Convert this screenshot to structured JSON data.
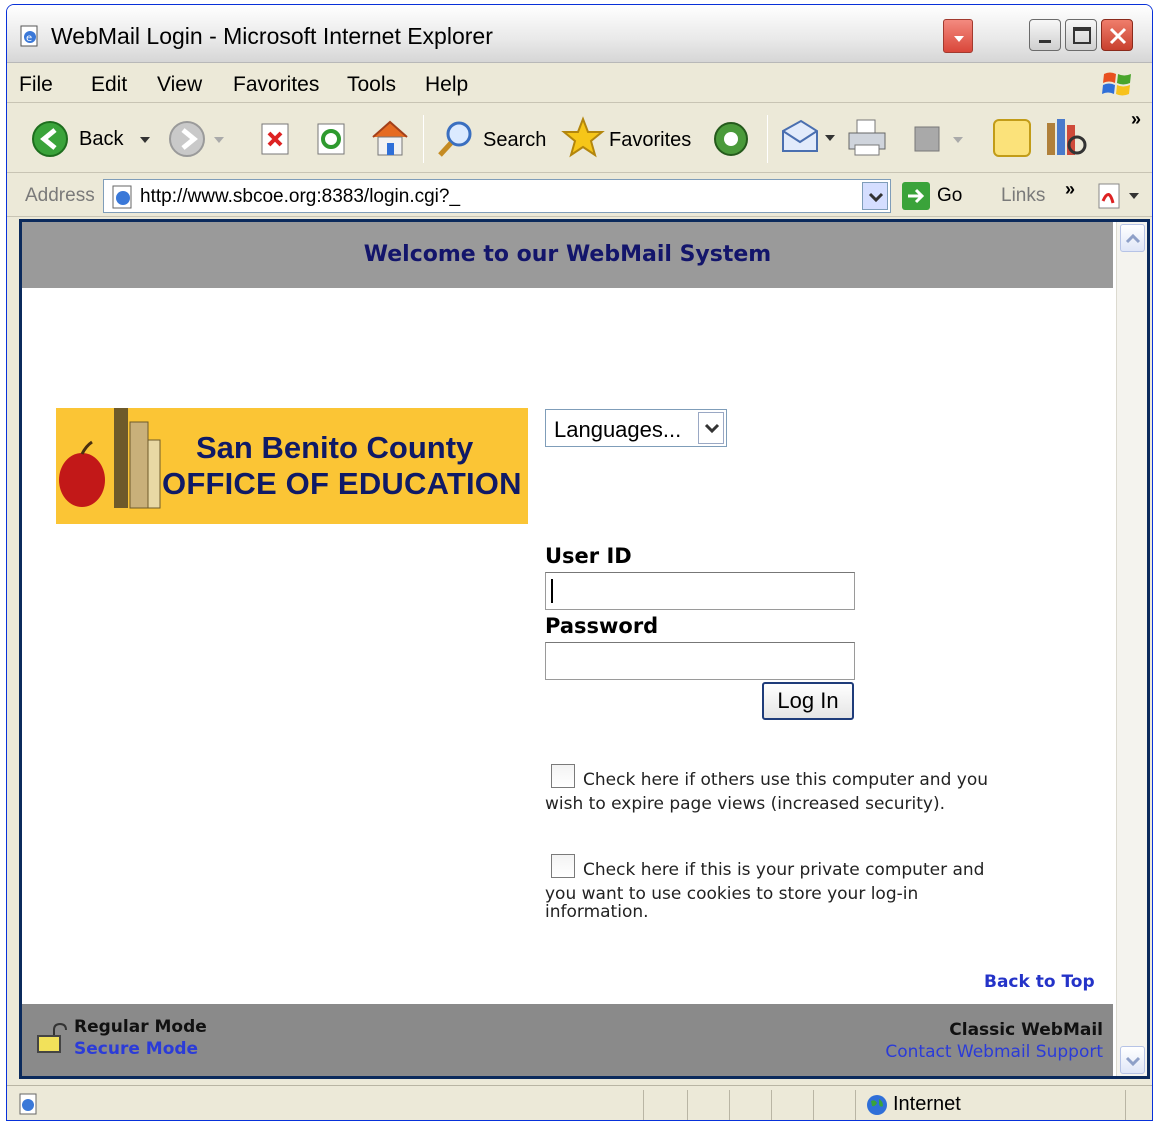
{
  "window": {
    "title": "WebMail Login - Microsoft Internet Explorer"
  },
  "menu": {
    "items": [
      {
        "label": "File",
        "accel": "F"
      },
      {
        "label": "Edit",
        "accel": "E"
      },
      {
        "label": "View",
        "accel": "V"
      },
      {
        "label": "Favorites",
        "accel": "a"
      },
      {
        "label": "Tools",
        "accel": "T"
      },
      {
        "label": "Help",
        "accel": "H"
      }
    ]
  },
  "toolbar": {
    "back_label": "Back",
    "search_label": "Search",
    "favorites_label": "Favorites",
    "overflow": "»"
  },
  "address": {
    "label": "Address",
    "url": "http://www.sbcoe.org:8383/login.cgi?_",
    "go_label": "Go",
    "links_label": "Links",
    "links_overflow": "»"
  },
  "page": {
    "header_title": "Welcome to our WebMail System",
    "logo": {
      "line1": "San Benito County",
      "line2": "OFFICE OF EDUCATION"
    },
    "language_select": "Languages...",
    "user_id_label": "User ID",
    "user_id_value": "",
    "password_label": "Password",
    "password_value": "",
    "login_button": "Log In",
    "expire_checkbox": {
      "checked": false,
      "text_line1": "Check here if others use this computer and you",
      "text_line2": "wish to expire page views (increased security)."
    },
    "cookie_checkbox": {
      "checked": false,
      "text_line1": "Check here if this is your private computer and",
      "text_line2": "you want to use cookies to store your log-in",
      "text_line3": "information."
    },
    "back_to_top": "Back to Top",
    "footer": {
      "regular_mode": "Regular Mode",
      "secure_mode": "Secure Mode",
      "classic_webmail": "Classic WebMail",
      "contact_support": "Contact Webmail Support"
    }
  },
  "status": {
    "zone": "Internet"
  },
  "colors": {
    "header_bg": "#9a9a9a",
    "header_text": "#13156b",
    "logo_bg": "#fbc535",
    "link_blue": "#2433c8",
    "footer_bg": "#8a8a8a",
    "viewport_border": "#0b2a5c"
  },
  "icons": [
    "ie-page-icon",
    "windows-logo-icon",
    "back-arrow-icon",
    "forward-arrow-icon",
    "stop-icon",
    "refresh-icon",
    "home-icon",
    "search-magnifier-icon",
    "favorites-star-icon",
    "media-icon",
    "mail-icon",
    "print-icon",
    "edit-icon",
    "messenger-icon",
    "research-icon",
    "go-arrow-icon",
    "acrobat-icon",
    "lock-icon",
    "internet-globe-icon"
  ]
}
